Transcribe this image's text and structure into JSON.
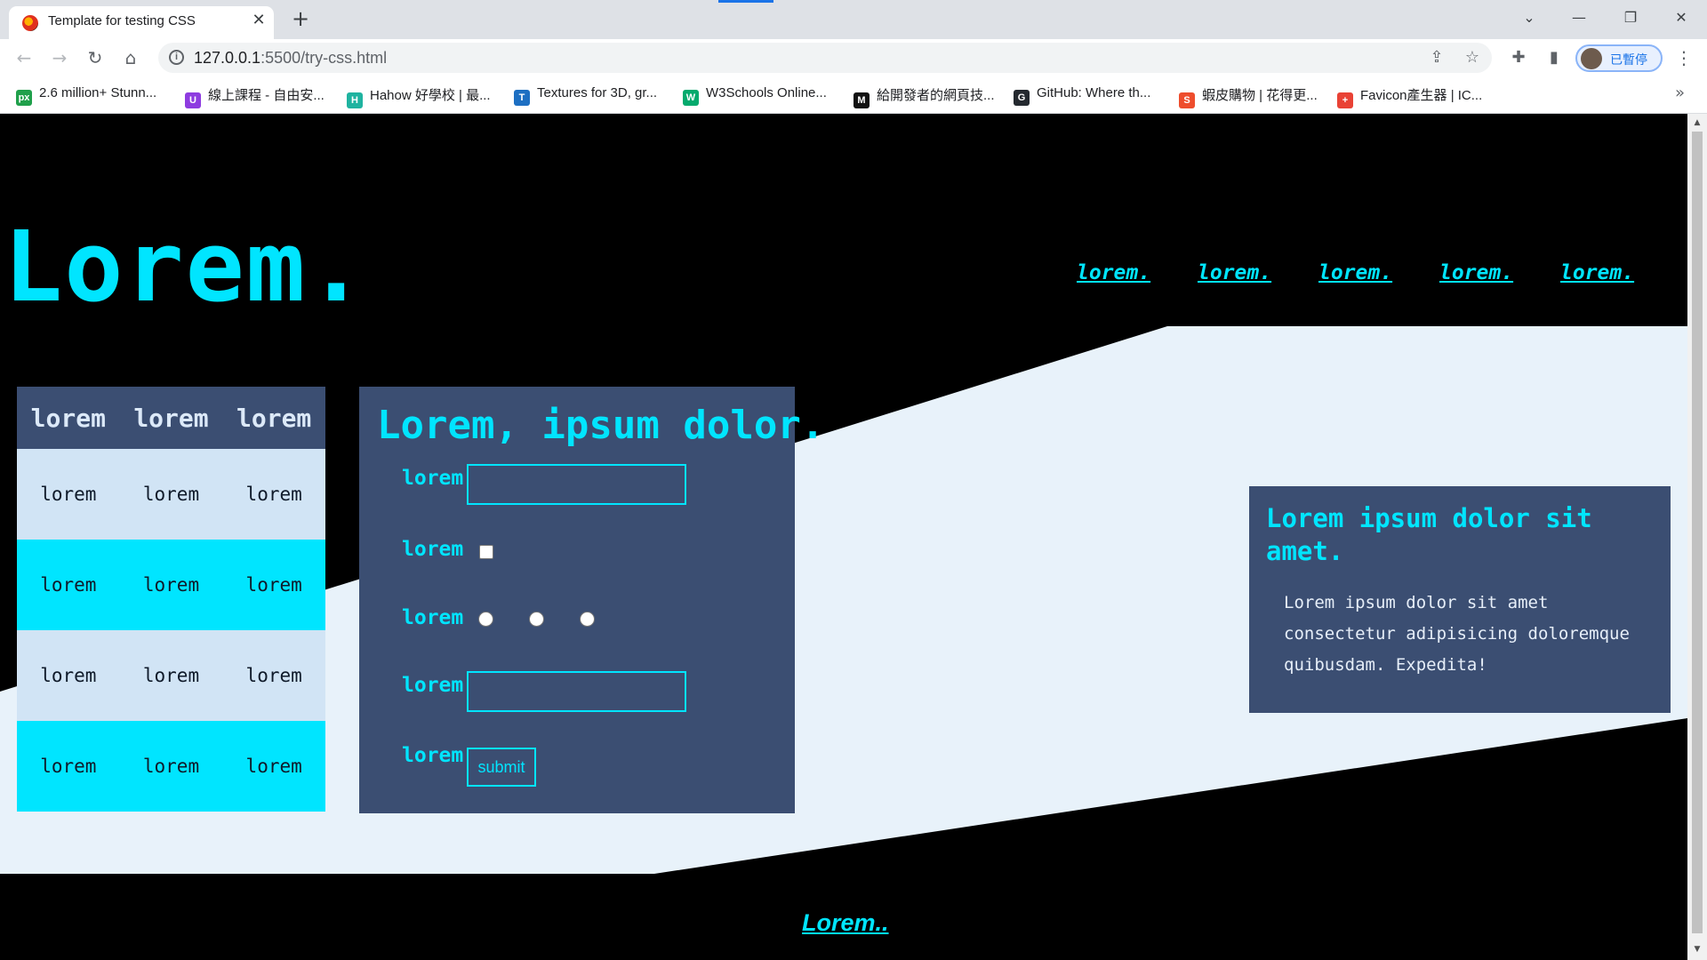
{
  "browser": {
    "tab_title": "Template for testing CSS",
    "url_host": "127.0.0.1",
    "url_path": ":5500/try-css.html",
    "profile_label": "已暫停",
    "bookmarks": [
      {
        "label": "2.6 million+ Stunn...",
        "icon": "px-icon",
        "color": "#20a04b",
        "glyph": "px"
      },
      {
        "label": "線上課程 - 自由安...",
        "icon": "course-icon",
        "color": "#8e3ce0",
        "glyph": "U"
      },
      {
        "label": "Hahow 好學校 | 最...",
        "icon": "hahow-icon",
        "color": "#1fb3a0",
        "glyph": "H"
      },
      {
        "label": "Textures for 3D, gr...",
        "icon": "textures-icon",
        "color": "#1d6fc2",
        "glyph": "T"
      },
      {
        "label": "W3Schools Online...",
        "icon": "w3schools-icon",
        "color": "#04aa6d",
        "glyph": "W"
      },
      {
        "label": "給開發者的網頁技...",
        "icon": "mdn-icon",
        "color": "#111111",
        "glyph": "M"
      },
      {
        "label": "GitHub: Where th...",
        "icon": "github-icon",
        "color": "#24292f",
        "glyph": "G"
      },
      {
        "label": "蝦皮購物 | 花得更...",
        "icon": "shopee-icon",
        "color": "#ee4d2d",
        "glyph": "S"
      },
      {
        "label": "Favicon產生器 | IC...",
        "icon": "favicon-icon",
        "color": "#e94235",
        "glyph": "+"
      }
    ]
  },
  "page": {
    "logo": "Lorem.",
    "nav": [
      "lorem.",
      "lorem.",
      "lorem.",
      "lorem.",
      "lorem."
    ],
    "table": {
      "headers": [
        "lorem",
        "lorem",
        "lorem"
      ],
      "rows": [
        [
          "lorem",
          "lorem",
          "lorem"
        ],
        [
          "lorem",
          "lorem",
          "lorem"
        ],
        [
          "lorem",
          "lorem",
          "lorem"
        ],
        [
          "lorem",
          "lorem",
          "lorem"
        ]
      ]
    },
    "form": {
      "title": "Lorem, ipsum dolor.",
      "labels": [
        "lorem",
        "lorem",
        "lorem",
        "lorem",
        "lorem"
      ],
      "submit": "submit"
    },
    "card": {
      "title": "Lorem ipsum dolor sit amet.",
      "body": "Lorem ipsum dolor sit amet consectetur adipisicing doloremque quibusdam. Expedita!"
    },
    "footer_link": "Lorem.."
  },
  "colors": {
    "accent": "#00e5ff",
    "panel": "#3b4e72",
    "light_band": "#e8f2fa",
    "background": "#000000"
  }
}
